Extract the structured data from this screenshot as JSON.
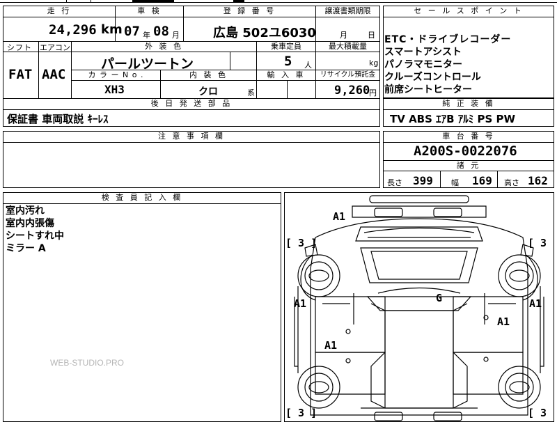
{
  "header": {
    "mileage_label": "走 行",
    "inspection_label": "車 検",
    "registration_label": "登 録 番 号",
    "transfer_label": "譲渡書類期限",
    "sales_points_label": "セ ー ル ス ポ イ ン ト"
  },
  "values": {
    "mileage": "24,296",
    "mileage_unit": "km",
    "inspection_year": "07",
    "year_unit": "年",
    "inspection_month": "08",
    "month_unit": "月",
    "registration": "広島 502ユ6030",
    "transfer_month_unit": "月",
    "transfer_day_unit": "日"
  },
  "sales_points": [
    "ETC・ドライブレコーダー",
    "スマートアシスト",
    "パノラマモニター",
    "クルーズコントロール",
    "前席シートヒーター"
  ],
  "specs": {
    "shift_label": "シフト",
    "ac_label": "エアコン",
    "exterior_label": "外 装 色",
    "capacity_label": "乗車定員",
    "max_load_label": "最大積載量",
    "shift": "FAT",
    "ac": "AAC",
    "exterior_color": "パールツートン",
    "capacity": "5",
    "capacity_unit": "人",
    "load_unit": "kg",
    "color_no_label": "カ ラ ー N o .",
    "interior_label": "内 装 色",
    "import_label": "輸 入 車",
    "recycle_label": "リサイクル預託金",
    "color_no": "XH3",
    "interior_color": "クロ",
    "interior_suffix": "系",
    "recycle_amount": "9,260",
    "recycle_unit": "円"
  },
  "accessories": {
    "label": "後 日 発 送 部 品",
    "value": "保証書 車両取説 ｷｰﾚｽ"
  },
  "genuine": {
    "label": "純 正 装 備",
    "value": "TV ABS ｴｱB ｱﾙﾐ PS PW"
  },
  "notes": {
    "label": "注 意 事 項 欄"
  },
  "chassis": {
    "label": "車 台 番 号",
    "value": "A200S-0022076"
  },
  "dimensions": {
    "label": "諸 元",
    "length_label": "長さ",
    "length": "399",
    "width_label": "幅",
    "width": "169",
    "height_label": "高さ",
    "height": "162"
  },
  "inspector": {
    "label": "検 査 員 記 入 欄",
    "lines": [
      "室内汚れ",
      "室内内張傷",
      "シートすれ中",
      "ミラー A"
    ]
  },
  "watermark": "WEB-STUDIO.PRO",
  "diagram": {
    "marks": [
      "A1",
      "[ 3 ]",
      "[ 3 ]",
      "[ 3 ]",
      "[ 3 ]",
      "A1",
      "A1",
      "G",
      "A1",
      "A1"
    ]
  }
}
